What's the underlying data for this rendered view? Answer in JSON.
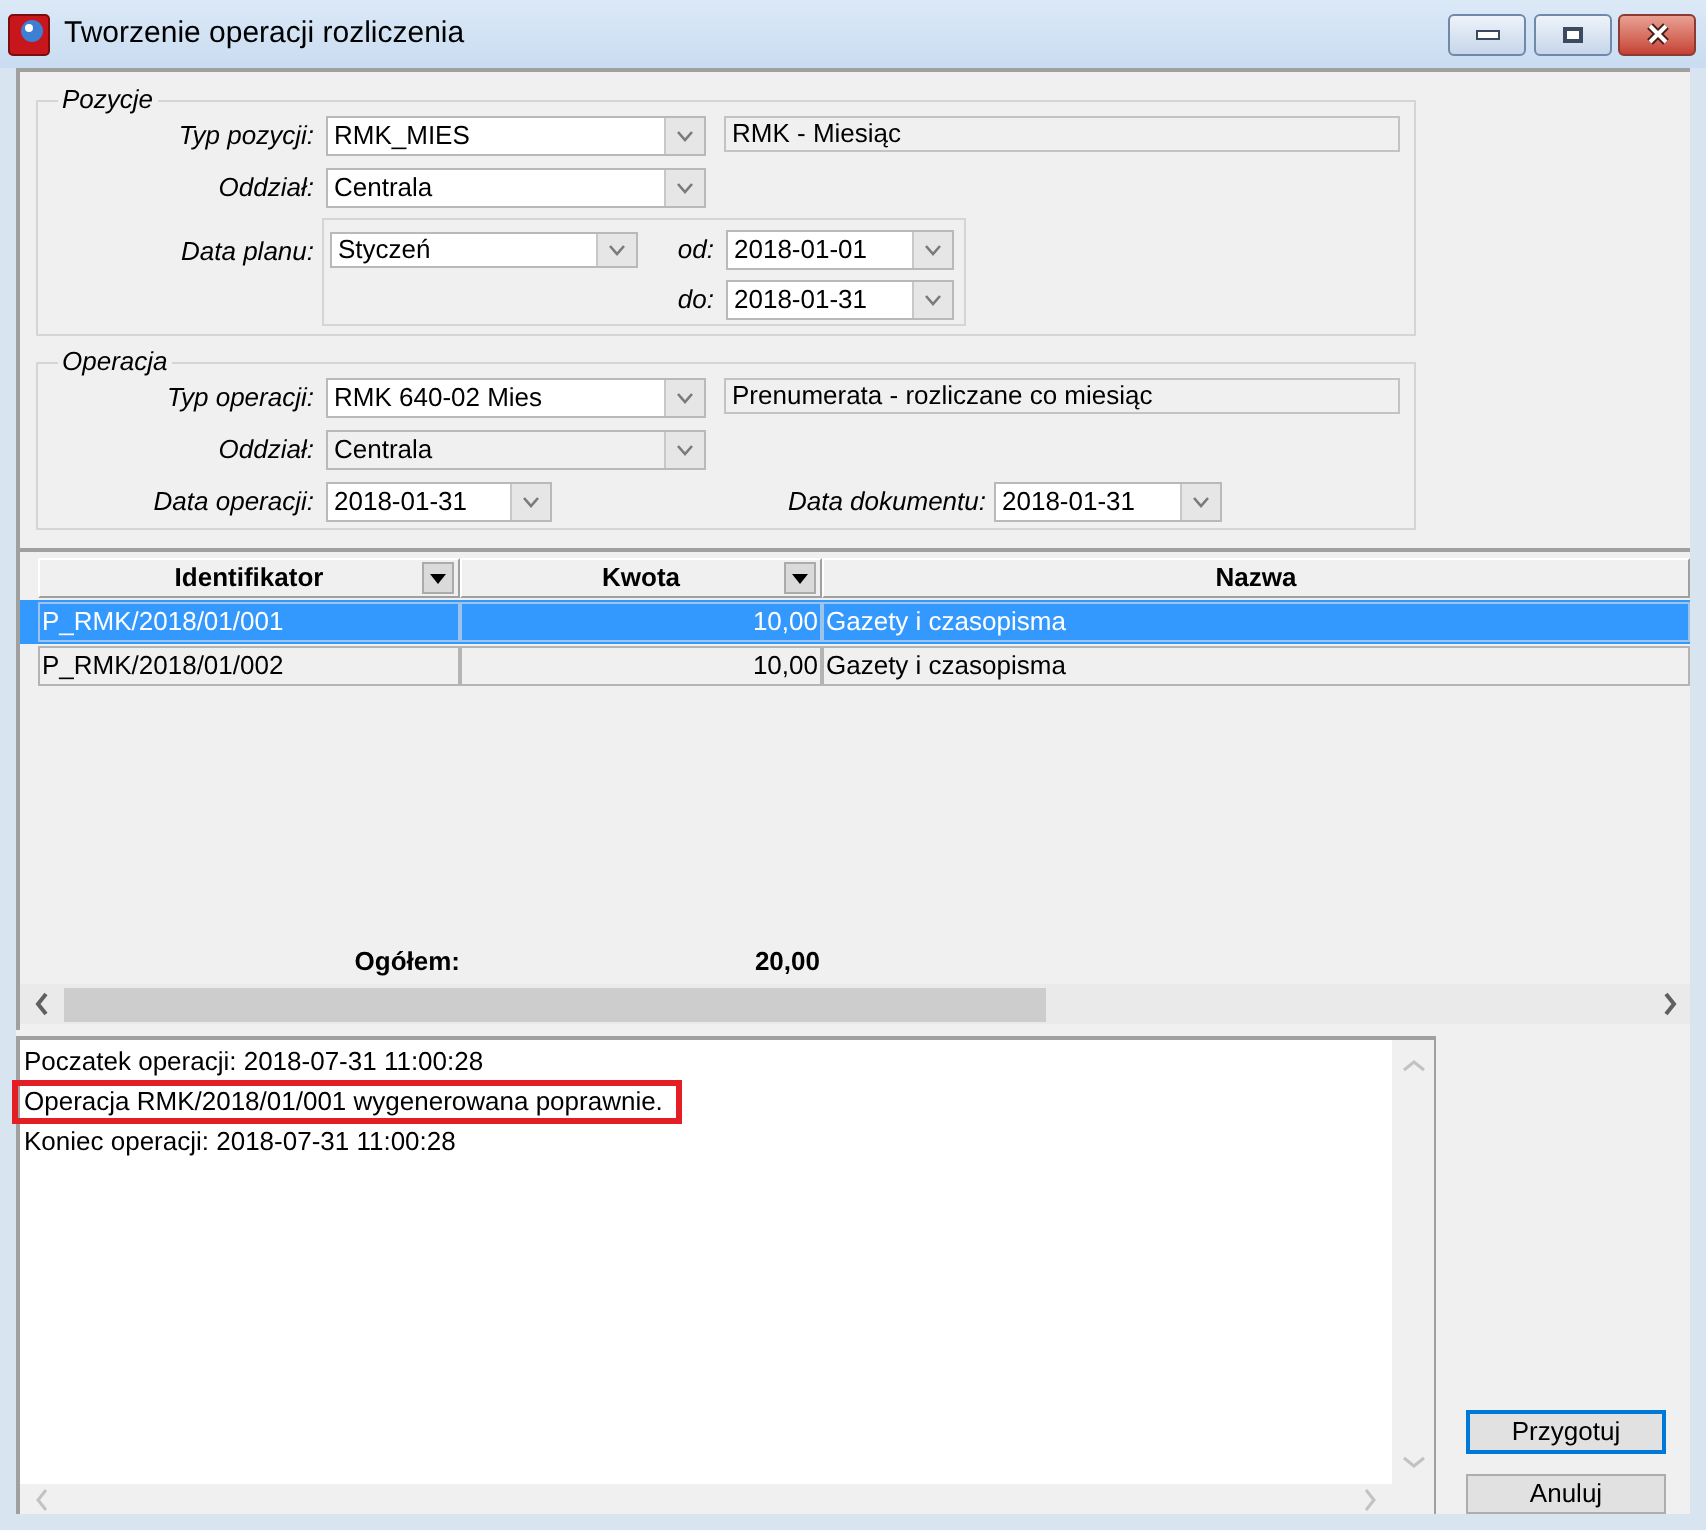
{
  "window": {
    "title": "Tworzenie operacji rozliczenia"
  },
  "pozycje": {
    "legend": "Pozycje",
    "typ_pozycji": {
      "label": "Typ pozycji:",
      "value": "RMK_MIES",
      "disabled": false,
      "description": "RMK - Miesiąc"
    },
    "oddzial": {
      "label": "Oddział:",
      "value": "Centrala",
      "disabled": false
    },
    "data_planu": {
      "label": "Data planu:",
      "month": {
        "value": "Styczeń",
        "disabled": false
      },
      "od": {
        "label": "od:",
        "value": "2018-01-01",
        "disabled": false
      },
      "do": {
        "label": "do:",
        "value": "2018-01-31",
        "disabled": false
      }
    }
  },
  "operacja": {
    "legend": "Operacja",
    "typ_operacji": {
      "label": "Typ operacji:",
      "value": "RMK 640-02 Mies",
      "disabled": false,
      "description": "Prenumerata - rozliczane co miesiąc"
    },
    "oddzial": {
      "label": "Oddział:",
      "value": "Centrala",
      "disabled": true
    },
    "data_operacji": {
      "label": "Data operacji:",
      "value": "2018-01-31",
      "disabled": false
    },
    "data_dokumentu": {
      "label": "Data dokumentu:",
      "value": "2018-01-31",
      "disabled": false
    }
  },
  "table": {
    "columns": [
      {
        "label": "Identifikator",
        "kind": "text",
        "filter": true
      },
      {
        "label": "Kwota",
        "kind": "amount",
        "filter": true
      },
      {
        "label": "Nazwa",
        "kind": "text",
        "filter": false
      }
    ],
    "rows": [
      {
        "selected": true,
        "cells": [
          "P_RMK/2018/01/001",
          "10,00",
          "Gazety i czasopisma"
        ]
      },
      {
        "selected": false,
        "cells": [
          "P_RMK/2018/01/002",
          "10,00",
          "Gazety i czasopisma"
        ]
      }
    ],
    "total": {
      "label": "Ogółem:",
      "value": "20,00"
    }
  },
  "log": {
    "lines": [
      {
        "text": "Poczatek operacji: 2018-07-31 11:00:28",
        "highlighted": false
      },
      {
        "text": "Operacja RMK/2018/01/001 wygenerowana poprawnie.",
        "highlighted": true
      },
      {
        "text": "Koniec operacji: 2018-07-31 11:00:28",
        "highlighted": false
      }
    ]
  },
  "buttons": [
    {
      "label": "Przygotuj",
      "focused": true
    },
    {
      "label": "Anuluj",
      "focused": false
    }
  ]
}
